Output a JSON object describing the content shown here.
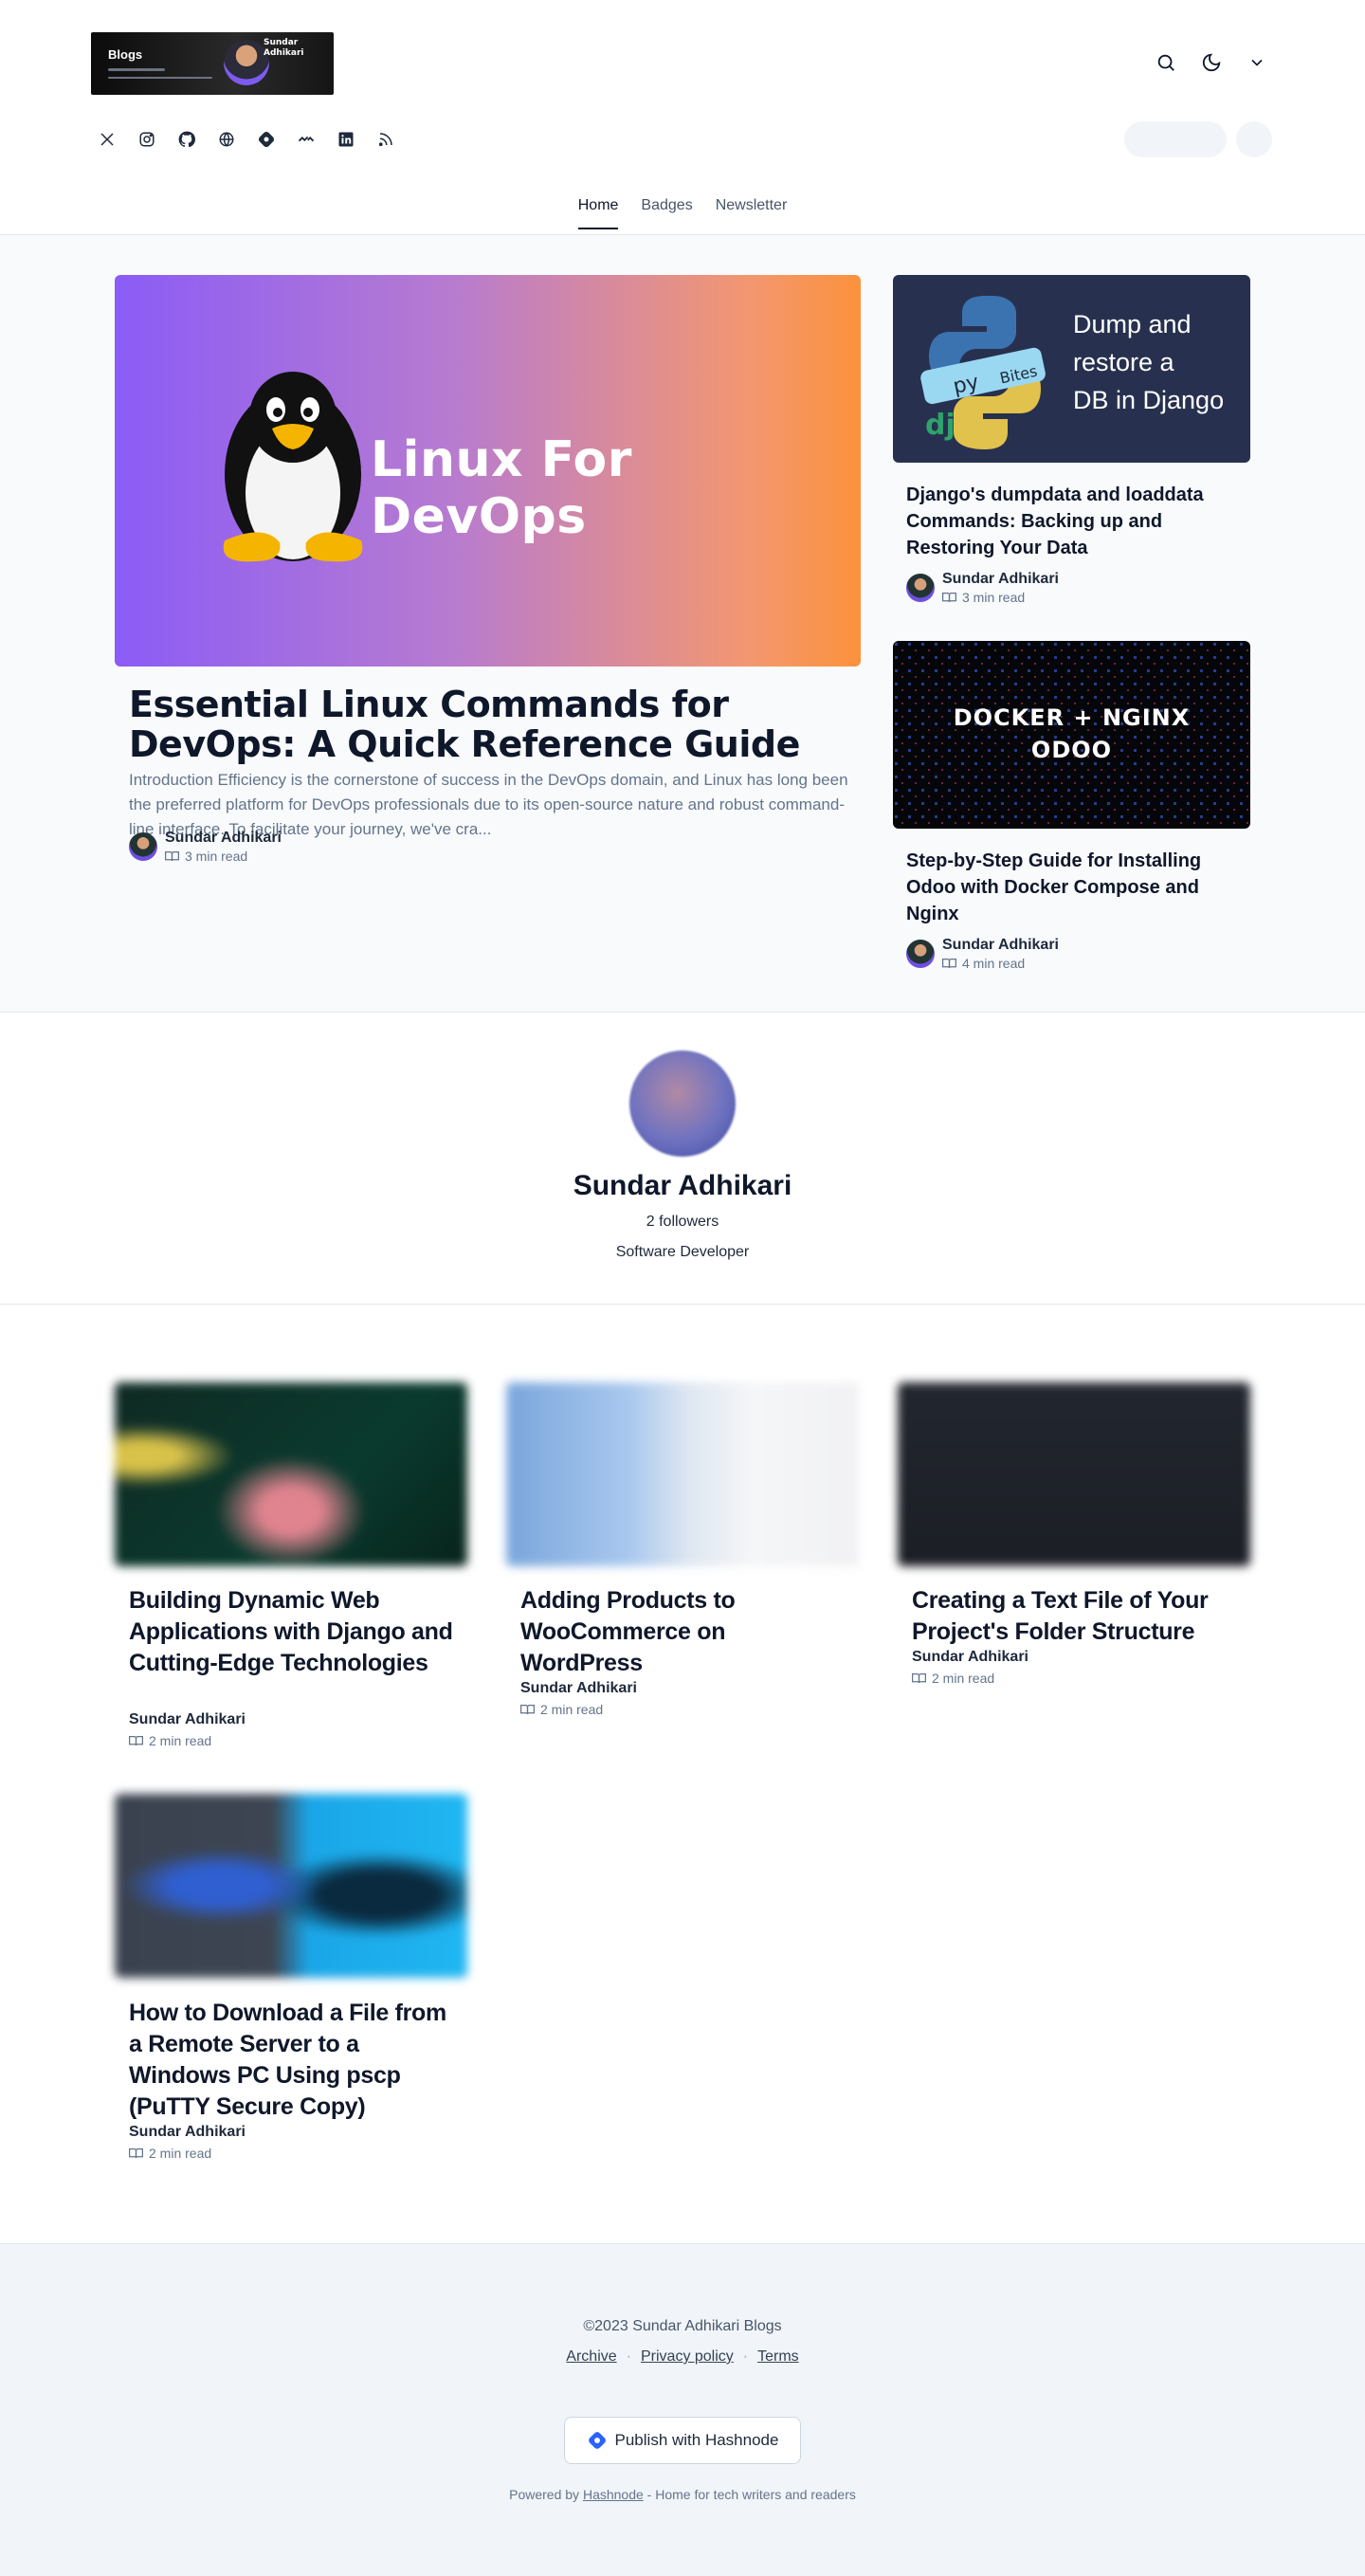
{
  "header": {
    "logo": {
      "title": "Blogs",
      "name_line1": "Sundar",
      "name_line2": "Adhikari"
    },
    "icons": [
      "search-icon",
      "moon-icon",
      "chevron-down-icon"
    ],
    "socials": [
      "x-icon",
      "instagram-icon",
      "github-icon",
      "globe-icon",
      "hashnode-icon",
      "dev-community-icon",
      "linkedin-icon",
      "rss-icon"
    ]
  },
  "nav": [
    {
      "label": "Home",
      "active": true
    },
    {
      "label": "Badges",
      "active": false
    },
    {
      "label": "Newsletter",
      "active": false
    }
  ],
  "featured": {
    "main": {
      "image_text": "Linux For DevOps",
      "title": "Essential Linux Commands for DevOps: A Quick Reference Guide",
      "excerpt": "Introduction Efficiency is the cornerstone of success in the DevOps domain, and Linux has long been the preferred platform for DevOps professionals due to its open-source nature and robust command-line interface. To facilitate your journey, we've cra...",
      "author": "Sundar Adhikari",
      "read_time": "3 min read"
    },
    "side": [
      {
        "image_text_lines": [
          "Dump and",
          "restore a",
          "DB in Django"
        ],
        "logo_words": [
          "py",
          "dj",
          "Bites"
        ],
        "title": "Django's dumpdata and loaddata Commands: Backing up and Restoring Your Data",
        "author": "Sundar Adhikari",
        "read_time": "3 min read"
      },
      {
        "image_text_lines": [
          "DOCKER + NGINX",
          "ODOO"
        ],
        "title": "Step-by-Step Guide for Installing Odoo with Docker Compose and Nginx",
        "author": "Sundar Adhikari",
        "read_time": "4 min read"
      }
    ]
  },
  "profile": {
    "name": "Sundar Adhikari",
    "followers": "2 followers",
    "bio": "Software Developer"
  },
  "posts": [
    {
      "title": "Building Dynamic Web Applications with Django and Cutting-Edge Technologies",
      "author": "Sundar Adhikari",
      "read_time": "2 min read"
    },
    {
      "title": "Adding Products to WooCommerce on WordPress",
      "author": "Sundar Adhikari",
      "read_time": "2 min read"
    },
    {
      "title": "Creating a Text File of Your Project's Folder Structure",
      "author": "Sundar Adhikari",
      "read_time": "2 min read"
    },
    {
      "title": "How to Download a File from a Remote Server to a Windows PC Using pscp (PuTTY Secure Copy)",
      "author": "Sundar Adhikari",
      "read_time": "2 min read"
    }
  ],
  "footer": {
    "copyright": "©2023 Sundar Adhikari Blogs",
    "links": [
      "Archive",
      "Privacy policy",
      "Terms"
    ],
    "separator": "·",
    "publish_label": "Publish with Hashnode",
    "powered_prefix": "Powered by",
    "powered_link": "Hashnode",
    "powered_suffix": "- Home for tech writers and readers"
  },
  "colors": {
    "accent": "#2962ff",
    "text": "#0f172a",
    "muted": "#64748b"
  }
}
